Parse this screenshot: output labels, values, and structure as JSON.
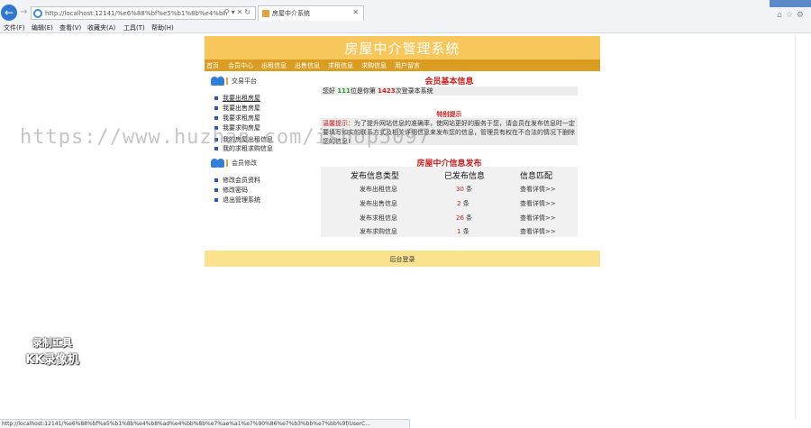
{
  "browser": {
    "url": "http://localhost:12141/%e6%88%bf%e5%b1%8b%e4%b8%ad",
    "tab_title": "房屋中介系统",
    "menu": [
      "文件(F)",
      "编辑(E)",
      "查看(V)",
      "收藏夹(A)",
      "工具(T)",
      "帮助(H)"
    ],
    "status_url": "http://localhost:12141/%e6%88%bf%e5%b1%8b%e4%b8%ad%e4%bb%8b%e7%ae%a1%e7%90%86%e7%b3%bb%e7%bb%9f/UserC..."
  },
  "site": {
    "title": "房屋中介管理系统",
    "nav": [
      "首页",
      "会员中心",
      "出租信息",
      "出售信息",
      "求租信息",
      "求购信息",
      "用户留言"
    ]
  },
  "sidebar": {
    "trade_heading": "交易平台",
    "trade_links": [
      "我要出租房屋",
      "我要出售房屋",
      "我要求租房屋",
      "我要求购房屋",
      "我的房屋出租信息",
      "我的求租求购信息"
    ],
    "member_heading": "会员修改",
    "member_links": [
      "修改会员资料",
      "修改密码",
      "退出管理系统"
    ]
  },
  "member_info": {
    "title": "会员基本信息",
    "prefix": "您好",
    "count": "111",
    "mid": "位是你第",
    "count2": "1423",
    "suffix": "次登录本系统"
  },
  "tip": {
    "title": "特别提示",
    "label": "温馨提示：",
    "text": "为了提升网站信息的准确率，使网站更好的服务于您，请会员在发布信息时一定要填写如实的联系方式及相关详细信息来发布您的信息，管理员有权在不合法的情况下删除您的信息!"
  },
  "publish": {
    "title": "房屋中介信息发布",
    "headers": [
      "发布信息类型",
      "已发布信息",
      "信息匹配"
    ],
    "rows": [
      {
        "type": "发布出租信息",
        "count": "30",
        "unit": "条",
        "link": "查看详情>>"
      },
      {
        "type": "发布出售信息",
        "count": "2",
        "unit": "条",
        "link": "查看详情>>"
      },
      {
        "type": "发布求租信息",
        "count": "26",
        "unit": "条",
        "link": "查看详情>>"
      },
      {
        "type": "发布求购信息",
        "count": "1",
        "unit": "条",
        "link": "查看详情>>"
      }
    ]
  },
  "footer": {
    "text": "后台登录"
  },
  "overlay": {
    "watermark": "https://www.huzhan.com/ishop5097",
    "kk_line1": "录制工具",
    "kk_line2": "KK录像机"
  }
}
